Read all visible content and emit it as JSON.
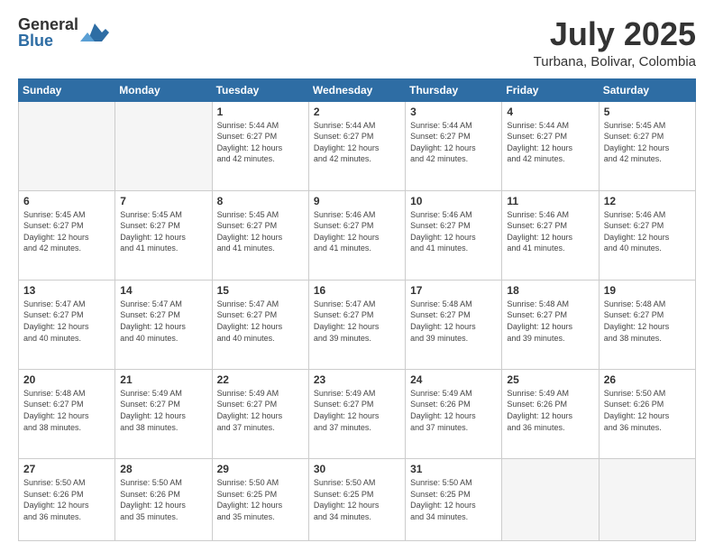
{
  "logo": {
    "general": "General",
    "blue": "Blue"
  },
  "title": {
    "month_year": "July 2025",
    "location": "Turbana, Bolivar, Colombia"
  },
  "weekdays": [
    "Sunday",
    "Monday",
    "Tuesday",
    "Wednesday",
    "Thursday",
    "Friday",
    "Saturday"
  ],
  "weeks": [
    [
      {
        "day": "",
        "info": ""
      },
      {
        "day": "",
        "info": ""
      },
      {
        "day": "1",
        "info": "Sunrise: 5:44 AM\nSunset: 6:27 PM\nDaylight: 12 hours\nand 42 minutes."
      },
      {
        "day": "2",
        "info": "Sunrise: 5:44 AM\nSunset: 6:27 PM\nDaylight: 12 hours\nand 42 minutes."
      },
      {
        "day": "3",
        "info": "Sunrise: 5:44 AM\nSunset: 6:27 PM\nDaylight: 12 hours\nand 42 minutes."
      },
      {
        "day": "4",
        "info": "Sunrise: 5:44 AM\nSunset: 6:27 PM\nDaylight: 12 hours\nand 42 minutes."
      },
      {
        "day": "5",
        "info": "Sunrise: 5:45 AM\nSunset: 6:27 PM\nDaylight: 12 hours\nand 42 minutes."
      }
    ],
    [
      {
        "day": "6",
        "info": "Sunrise: 5:45 AM\nSunset: 6:27 PM\nDaylight: 12 hours\nand 42 minutes."
      },
      {
        "day": "7",
        "info": "Sunrise: 5:45 AM\nSunset: 6:27 PM\nDaylight: 12 hours\nand 41 minutes."
      },
      {
        "day": "8",
        "info": "Sunrise: 5:45 AM\nSunset: 6:27 PM\nDaylight: 12 hours\nand 41 minutes."
      },
      {
        "day": "9",
        "info": "Sunrise: 5:46 AM\nSunset: 6:27 PM\nDaylight: 12 hours\nand 41 minutes."
      },
      {
        "day": "10",
        "info": "Sunrise: 5:46 AM\nSunset: 6:27 PM\nDaylight: 12 hours\nand 41 minutes."
      },
      {
        "day": "11",
        "info": "Sunrise: 5:46 AM\nSunset: 6:27 PM\nDaylight: 12 hours\nand 41 minutes."
      },
      {
        "day": "12",
        "info": "Sunrise: 5:46 AM\nSunset: 6:27 PM\nDaylight: 12 hours\nand 40 minutes."
      }
    ],
    [
      {
        "day": "13",
        "info": "Sunrise: 5:47 AM\nSunset: 6:27 PM\nDaylight: 12 hours\nand 40 minutes."
      },
      {
        "day": "14",
        "info": "Sunrise: 5:47 AM\nSunset: 6:27 PM\nDaylight: 12 hours\nand 40 minutes."
      },
      {
        "day": "15",
        "info": "Sunrise: 5:47 AM\nSunset: 6:27 PM\nDaylight: 12 hours\nand 40 minutes."
      },
      {
        "day": "16",
        "info": "Sunrise: 5:47 AM\nSunset: 6:27 PM\nDaylight: 12 hours\nand 39 minutes."
      },
      {
        "day": "17",
        "info": "Sunrise: 5:48 AM\nSunset: 6:27 PM\nDaylight: 12 hours\nand 39 minutes."
      },
      {
        "day": "18",
        "info": "Sunrise: 5:48 AM\nSunset: 6:27 PM\nDaylight: 12 hours\nand 39 minutes."
      },
      {
        "day": "19",
        "info": "Sunrise: 5:48 AM\nSunset: 6:27 PM\nDaylight: 12 hours\nand 38 minutes."
      }
    ],
    [
      {
        "day": "20",
        "info": "Sunrise: 5:48 AM\nSunset: 6:27 PM\nDaylight: 12 hours\nand 38 minutes."
      },
      {
        "day": "21",
        "info": "Sunrise: 5:49 AM\nSunset: 6:27 PM\nDaylight: 12 hours\nand 38 minutes."
      },
      {
        "day": "22",
        "info": "Sunrise: 5:49 AM\nSunset: 6:27 PM\nDaylight: 12 hours\nand 37 minutes."
      },
      {
        "day": "23",
        "info": "Sunrise: 5:49 AM\nSunset: 6:27 PM\nDaylight: 12 hours\nand 37 minutes."
      },
      {
        "day": "24",
        "info": "Sunrise: 5:49 AM\nSunset: 6:26 PM\nDaylight: 12 hours\nand 37 minutes."
      },
      {
        "day": "25",
        "info": "Sunrise: 5:49 AM\nSunset: 6:26 PM\nDaylight: 12 hours\nand 36 minutes."
      },
      {
        "day": "26",
        "info": "Sunrise: 5:50 AM\nSunset: 6:26 PM\nDaylight: 12 hours\nand 36 minutes."
      }
    ],
    [
      {
        "day": "27",
        "info": "Sunrise: 5:50 AM\nSunset: 6:26 PM\nDaylight: 12 hours\nand 36 minutes."
      },
      {
        "day": "28",
        "info": "Sunrise: 5:50 AM\nSunset: 6:26 PM\nDaylight: 12 hours\nand 35 minutes."
      },
      {
        "day": "29",
        "info": "Sunrise: 5:50 AM\nSunset: 6:25 PM\nDaylight: 12 hours\nand 35 minutes."
      },
      {
        "day": "30",
        "info": "Sunrise: 5:50 AM\nSunset: 6:25 PM\nDaylight: 12 hours\nand 34 minutes."
      },
      {
        "day": "31",
        "info": "Sunrise: 5:50 AM\nSunset: 6:25 PM\nDaylight: 12 hours\nand 34 minutes."
      },
      {
        "day": "",
        "info": ""
      },
      {
        "day": "",
        "info": ""
      }
    ]
  ]
}
